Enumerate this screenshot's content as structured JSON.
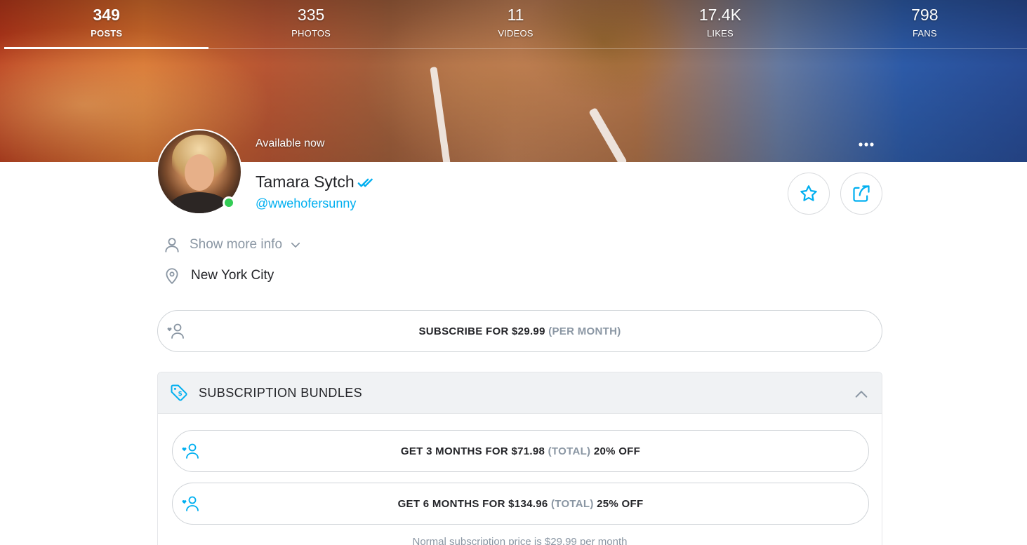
{
  "stats": [
    {
      "value": "349",
      "label": "POSTS",
      "active": true
    },
    {
      "value": "335",
      "label": "PHOTOS"
    },
    {
      "value": "11",
      "label": "VIDEOS"
    },
    {
      "value": "17.4K",
      "label": "LIKES"
    },
    {
      "value": "798",
      "label": "FANS"
    }
  ],
  "profile": {
    "status": "Available now",
    "name": "Tamara Sytch",
    "username": "@wwehofersunny",
    "show_more_label": "Show more info",
    "location": "New York City"
  },
  "subscribe": {
    "prefix": "SUBSCRIBE FOR $29.99",
    "suffix": "(PER MONTH)"
  },
  "bundles": {
    "title": "SUBSCRIPTION BUNDLES",
    "items": [
      {
        "prefix": "GET 3 MONTHS FOR $71.98",
        "total": "(TOTAL)",
        "discount": "20% OFF"
      },
      {
        "prefix": "GET 6 MONTHS FOR $134.96",
        "total": "(TOTAL)",
        "discount": "25% OFF"
      }
    ],
    "normal_price_note": "Normal subscription price is $29.99 per month"
  },
  "colors": {
    "accent": "#00aff0",
    "muted": "#8a96a3",
    "text": "#242529",
    "online": "#33cc55"
  },
  "icons": [
    "more-icon",
    "verified-icon",
    "star-icon",
    "share-icon",
    "user-icon",
    "chevron-down-icon",
    "location-pin-icon",
    "subscribe-heart-user-icon",
    "price-tag-icon",
    "chevron-up-icon"
  ]
}
